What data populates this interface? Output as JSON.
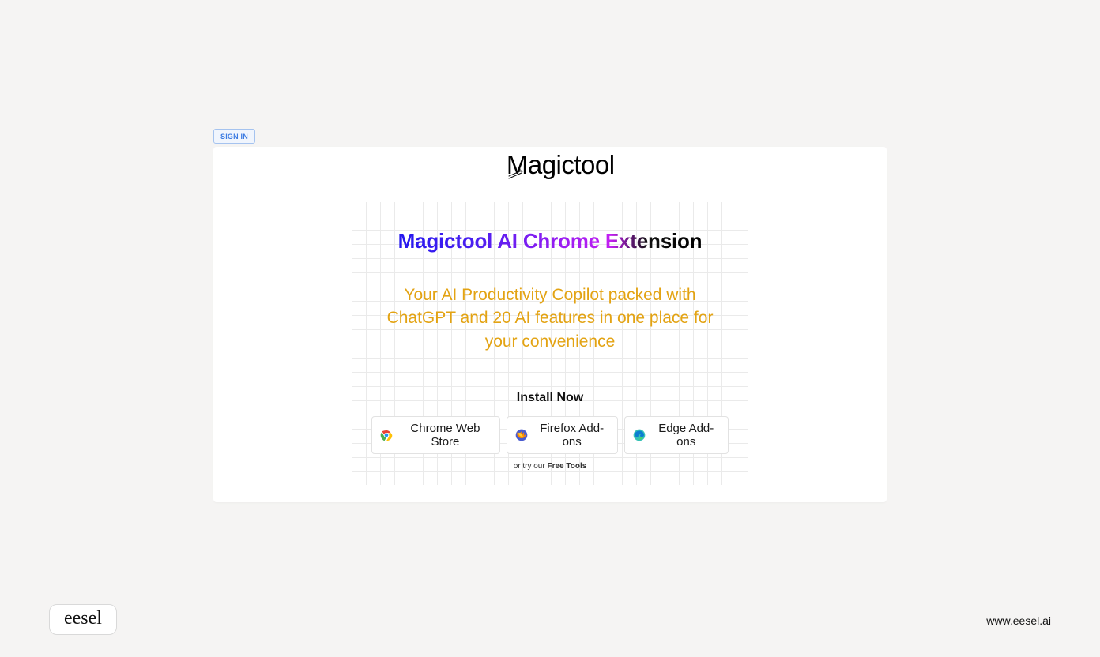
{
  "header": {
    "signin_label": "SIGN IN"
  },
  "logo": {
    "brand_name": "Magictool"
  },
  "hero": {
    "headline": "Magictool AI Chrome Extension",
    "subheadline": "Your AI Productivity Copilot packed with ChatGPT and 20 AI features in one place for your convenience",
    "install_heading": "Install Now",
    "stores": {
      "chrome": "Chrome Web Store",
      "firefox": "Firefox Add-ons",
      "edge": "Edge Add-ons"
    },
    "try_prefix": "or try our ",
    "try_link": "Free Tools"
  },
  "footer": {
    "badge_text": "eesel",
    "url_text": "www.eesel.ai"
  }
}
